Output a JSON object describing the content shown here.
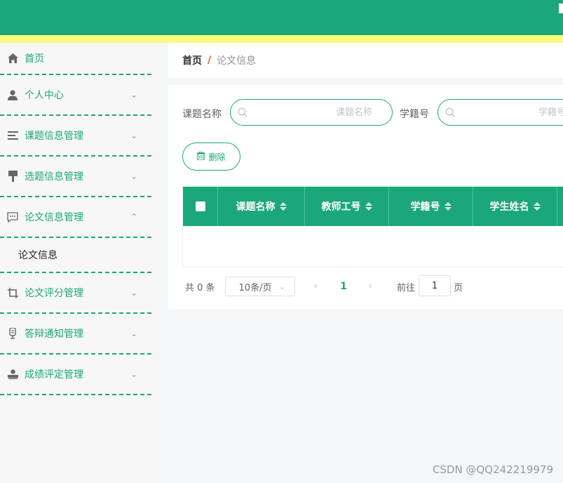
{
  "colors": {
    "primary": "#1ba77a",
    "stripe": "#fbfb7a",
    "sidebar_bg": "#f7f7f7"
  },
  "sidebar": {
    "items": [
      {
        "label": "首页",
        "icon": "home-icon",
        "has_arrow": false
      },
      {
        "label": "个人中心",
        "icon": "user-icon",
        "has_arrow": true,
        "arrow": "⌄"
      },
      {
        "label": "课题信息管理",
        "icon": "list-icon",
        "has_arrow": true,
        "arrow": "⌄"
      },
      {
        "label": "选题信息管理",
        "icon": "brush-icon",
        "has_arrow": true,
        "arrow": "⌄"
      },
      {
        "label": "论文信息管理",
        "icon": "chat-icon",
        "has_arrow": true,
        "arrow": "⌃"
      },
      {
        "label": "论文评分管理",
        "icon": "crop-icon",
        "has_arrow": true,
        "arrow": "⌄"
      },
      {
        "label": "答辩通知管理",
        "icon": "microphone-icon",
        "has_arrow": true,
        "arrow": "⌄"
      },
      {
        "label": "成绩评定管理",
        "icon": "stamp-icon",
        "has_arrow": true,
        "arrow": "⌄"
      }
    ],
    "submenu": {
      "label": "论文信息"
    }
  },
  "breadcrumb": {
    "home": "首页",
    "separator": "/",
    "current": "论文信息"
  },
  "search": {
    "topic_label": "课题名称",
    "topic_placeholder": "课题名称",
    "student_id_label": "学籍号",
    "student_id_placeholder": "学籍号"
  },
  "actions": {
    "delete_label": "删除"
  },
  "table": {
    "columns": [
      "课题名称",
      "教师工号",
      "学籍号",
      "学生姓名"
    ],
    "rows": []
  },
  "pagination": {
    "total_text": "共 0 条",
    "page_size": "10条/页",
    "prev": "‹",
    "current_page": "1",
    "next": "›",
    "goto_label": "前往",
    "goto_value": "1",
    "goto_suffix": "页"
  },
  "watermark": "CSDN @QQ242219979"
}
